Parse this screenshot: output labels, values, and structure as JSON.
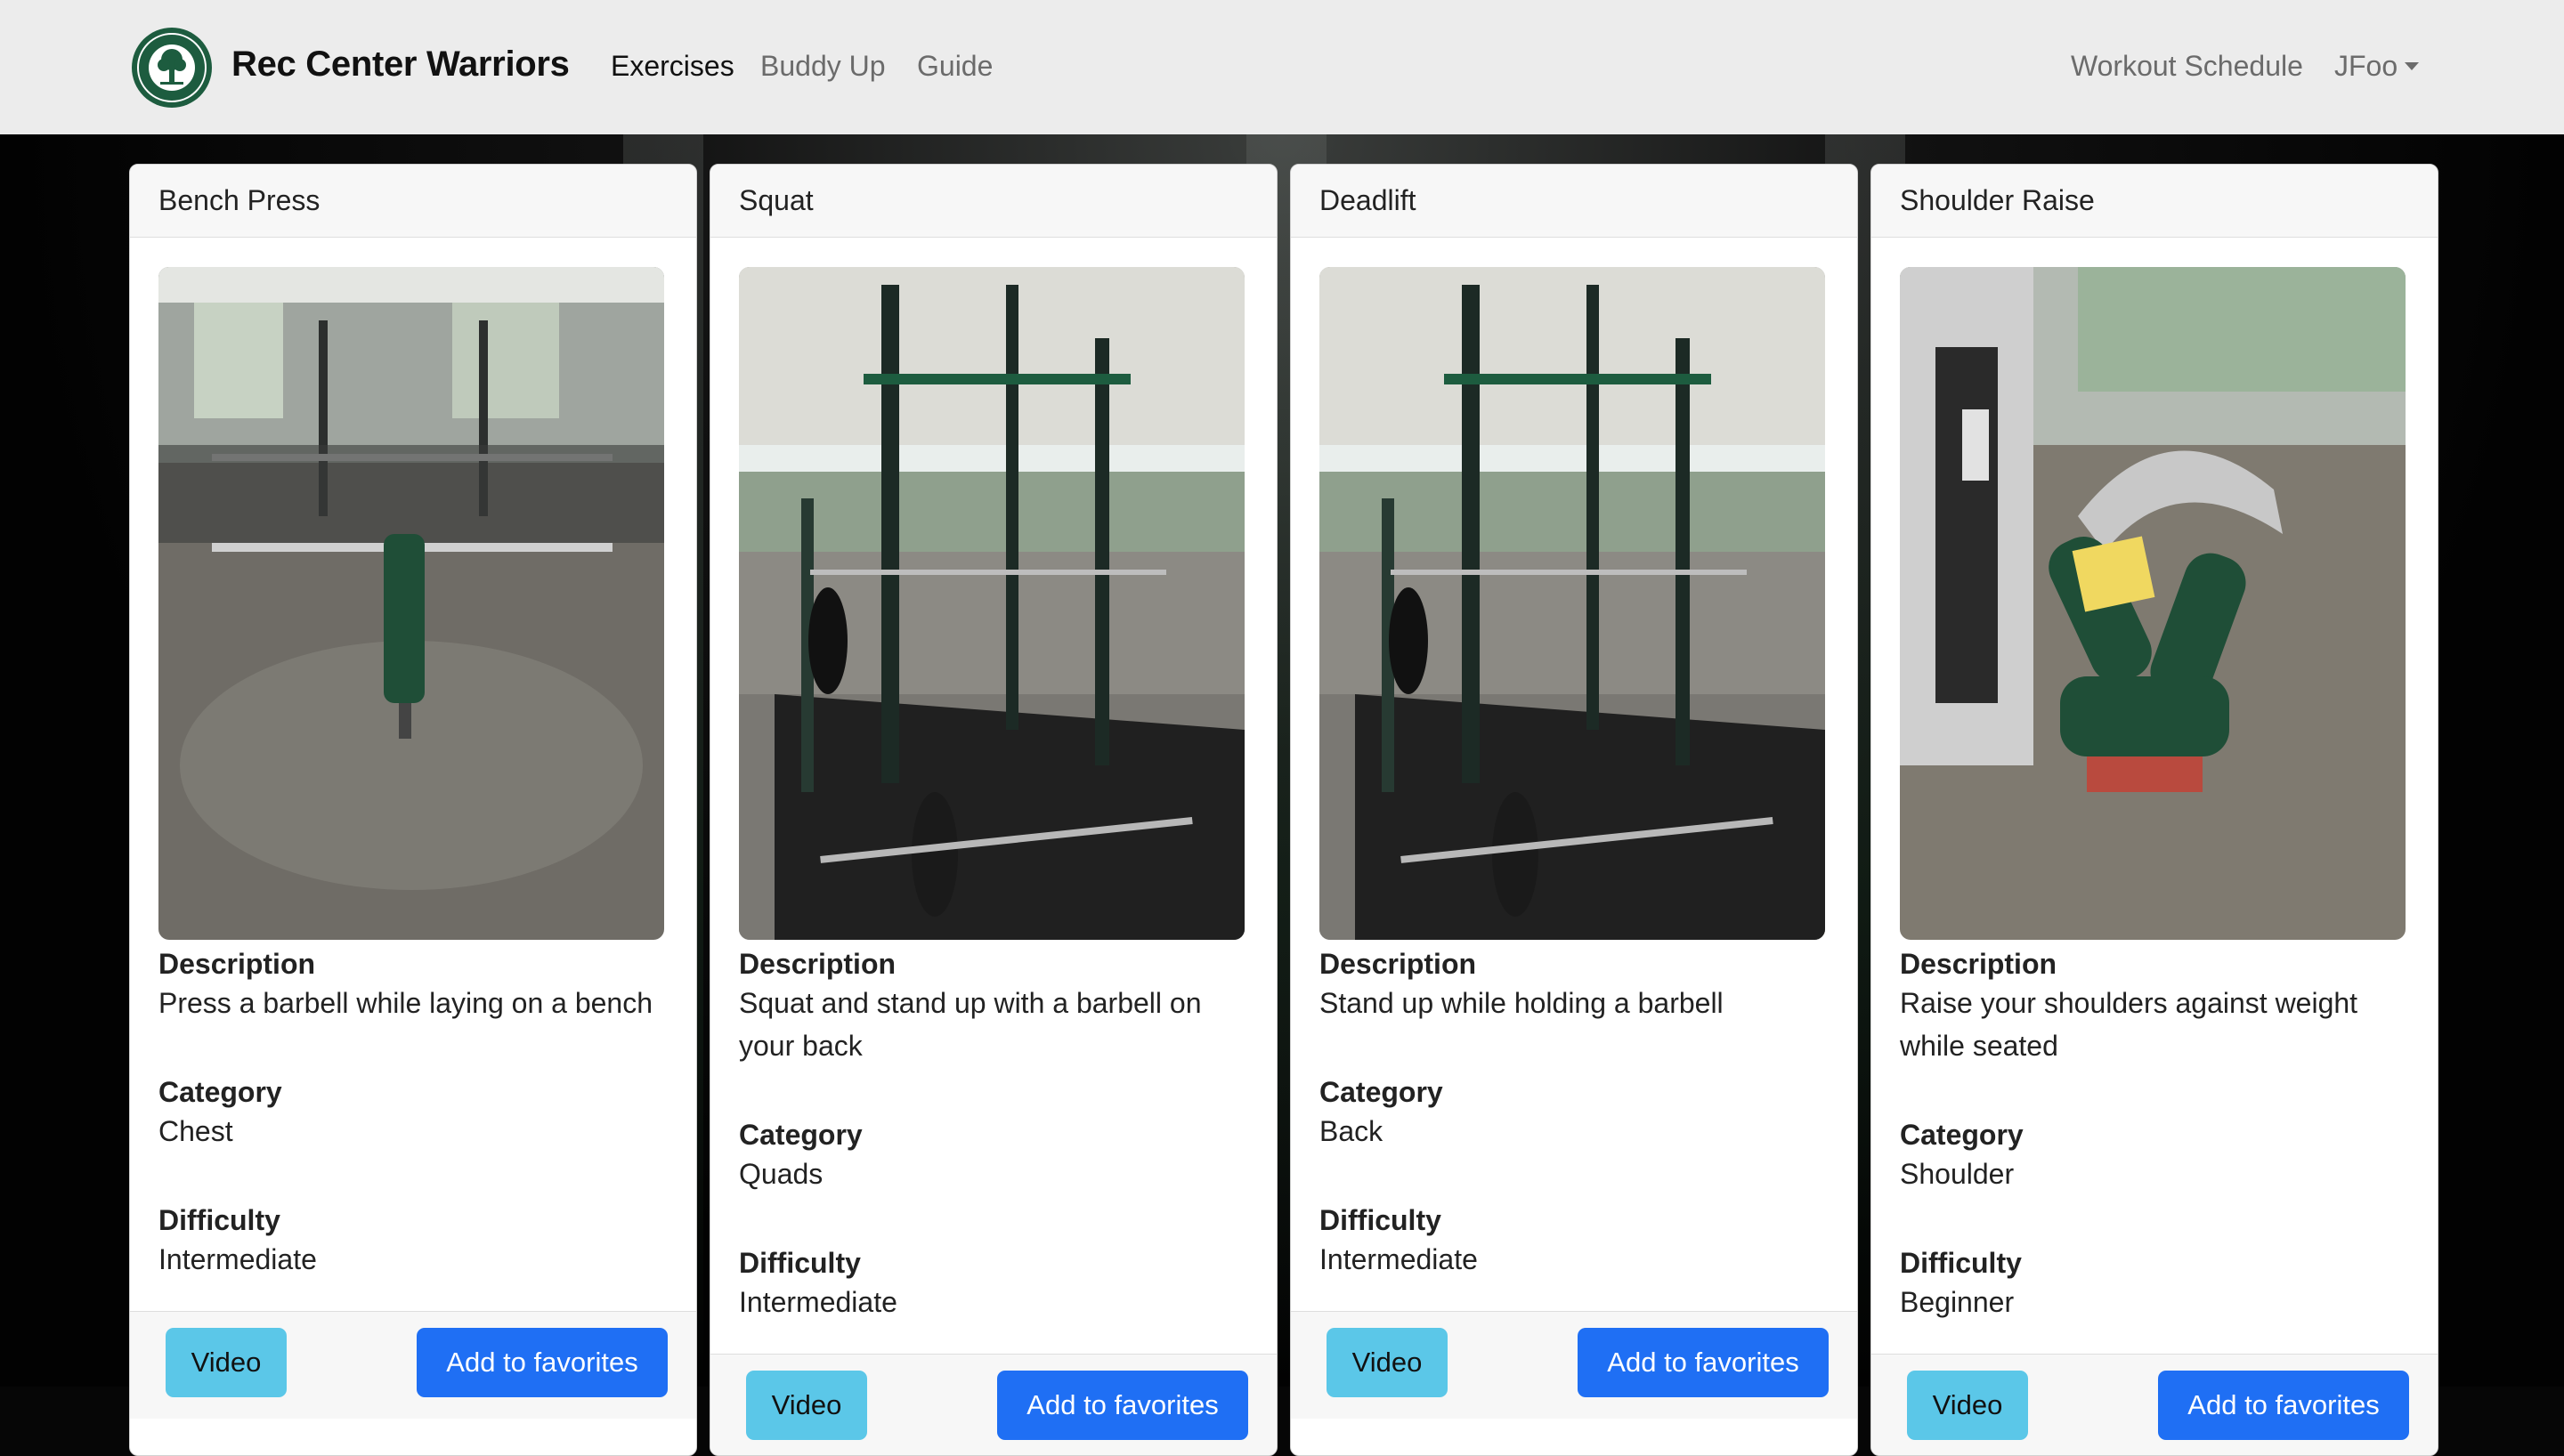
{
  "navbar": {
    "brand": "Rec Center Warriors",
    "links": [
      "Exercises",
      "Buddy Up",
      "Guide"
    ],
    "right_links": [
      "Workout Schedule"
    ],
    "user_menu": "JFoo"
  },
  "cards": [
    {
      "title": "Bench Press",
      "description_label": "Description",
      "description": "Press a barbell while laying on a bench",
      "category_label": "Category",
      "category": "Chest",
      "difficulty_label": "Difficulty",
      "difficulty": "Intermediate",
      "video_label": "Video",
      "favorite_label": "Add to favorites"
    },
    {
      "title": "Squat",
      "description_label": "Description",
      "description": "Squat and stand up with a barbell on your back",
      "category_label": "Category",
      "category": "Quads",
      "difficulty_label": "Difficulty",
      "difficulty": "Intermediate",
      "video_label": "Video",
      "favorite_label": "Add to favorites"
    },
    {
      "title": "Deadlift",
      "description_label": "Description",
      "description": "Stand up while holding a barbell",
      "category_label": "Category",
      "category": "Back",
      "difficulty_label": "Difficulty",
      "difficulty": "Intermediate",
      "video_label": "Video",
      "favorite_label": "Add to favorites"
    },
    {
      "title": "Shoulder Raise",
      "description_label": "Description",
      "description": "Raise your shoulders against weight while seated",
      "category_label": "Category",
      "category": "Shoulder",
      "difficulty_label": "Difficulty",
      "difficulty": "Beginner",
      "video_label": "Video",
      "favorite_label": "Add to favorites"
    }
  ],
  "colors": {
    "accent_green": "#1d5c3f",
    "video_button": "#5bc7e8",
    "favorite_button": "#1f6ff4",
    "navbar_bg": "#ececec"
  }
}
